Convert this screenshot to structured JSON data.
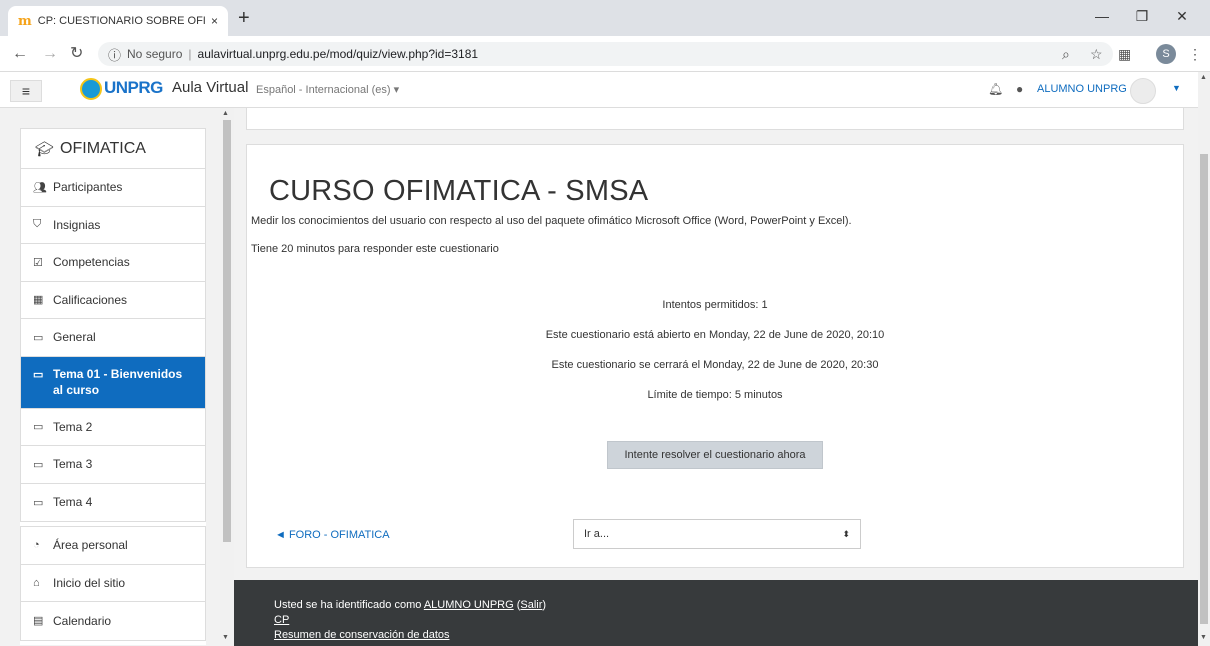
{
  "browser": {
    "tab_title": "CP: CUESTIONARIO SOBRE OFIM",
    "tab_close": "×",
    "new_tab": "+",
    "favicon": "m",
    "address": {
      "security_label": "No seguro",
      "separator": "|",
      "url": "aulavirtual.unprg.edu.pe/mod/quiz/view.php?id=3181"
    },
    "profile_initial": "S"
  },
  "navbar": {
    "logo_text": "UNPRG",
    "site_name": "Aula Virtual",
    "language": "Español - Internacional (es) ▾",
    "user_name": "ALUMNO UNPRG"
  },
  "drawer": {
    "course": "OFIMATICA",
    "course_items": [
      {
        "label": "Participantes",
        "icon": "users-icon"
      },
      {
        "label": "Insignias",
        "icon": "shield-icon"
      },
      {
        "label": "Competencias",
        "icon": "check-square-icon"
      },
      {
        "label": "Calificaciones",
        "icon": "table-icon"
      },
      {
        "label": "General",
        "icon": "folder-icon"
      },
      {
        "label": "Tema 01 - Bienvenidos al curso",
        "icon": "folder-icon",
        "active": true
      },
      {
        "label": "Tema 2",
        "icon": "folder-icon"
      },
      {
        "label": "Tema 3",
        "icon": "folder-icon"
      },
      {
        "label": "Tema 4",
        "icon": "folder-icon"
      }
    ],
    "site_items": [
      {
        "label": "Área personal",
        "icon": "tachometer-icon"
      },
      {
        "label": "Inicio del sitio",
        "icon": "home-icon"
      },
      {
        "label": "Calendario",
        "icon": "calendar-icon"
      }
    ]
  },
  "quiz": {
    "title": "CURSO OFIMATICA - SMSA",
    "description": "Medir los conocimientos del usuario con respecto al uso del paquete ofimático Microsoft Office (Word, PowerPoint y Excel).",
    "time_note": "Tiene 20 minutos para responder este cuestionario",
    "attempts": "Intentos permitidos: 1",
    "opens": "Este cuestionario está abierto en Monday, 22 de June de 2020, 20:10",
    "closes": "Este cuestionario se cerrará el Monday, 22 de June de 2020, 20:30",
    "time_limit": "Límite de tiempo: 5 minutos",
    "attempt_button": "Intente resolver el cuestionario ahora",
    "prev_link": "◄ FORO - OFIMATICA",
    "jump_select": "Ir a..."
  },
  "footer": {
    "logged_in_prefix": "Usted se ha identificado como ",
    "logged_in_user": "ALUMNO UNPRG",
    "logout_open": " (",
    "logout": "Salir",
    "logout_close": ")",
    "course_short": "CP",
    "data_retention": "Resumen de conservación de datos"
  },
  "colors": {
    "brand": "#0f6cbf",
    "footer_bg": "#373a3c",
    "page_bg": "#f2f2f2",
    "button_bg": "#ced4da"
  }
}
